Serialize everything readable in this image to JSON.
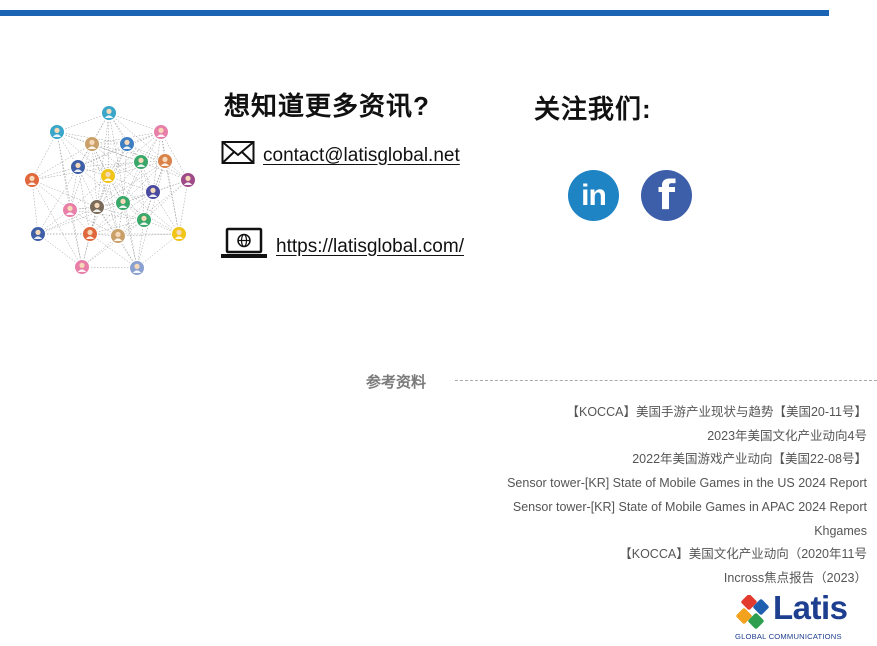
{
  "contact": {
    "title": "想知道更多资讯?",
    "email": "contact@latisglobal.net",
    "website": "https://latisglobal.com/"
  },
  "follow": {
    "title": "关注我们:",
    "linkedin_label": "in",
    "facebook_label": "f"
  },
  "references": {
    "title": "参考资料",
    "items": [
      "【KOCCA】美国手游产业现状与趋势【美国20-11号】",
      "2023年美国文化产业动向4号",
      "2022年美国游戏产业动向【美国22-08号】",
      "Sensor tower-[KR] State of Mobile Games in the US 2024 Report",
      "Sensor tower-[KR] State of Mobile Games in APAC 2024 Report",
      "Khgames",
      "【KOCCA】美国文化产业动向（2020年11号",
      "Incross焦点报告（2023）"
    ]
  },
  "logo": {
    "name": "Latis",
    "tagline": "GLOBAL COMMUNICATIONS"
  },
  "colors": {
    "accent_bar": "#1b63b3",
    "linkedin": "#1f84c4",
    "facebook": "#3d5ea8",
    "logo_text": "#1e3f8f"
  }
}
